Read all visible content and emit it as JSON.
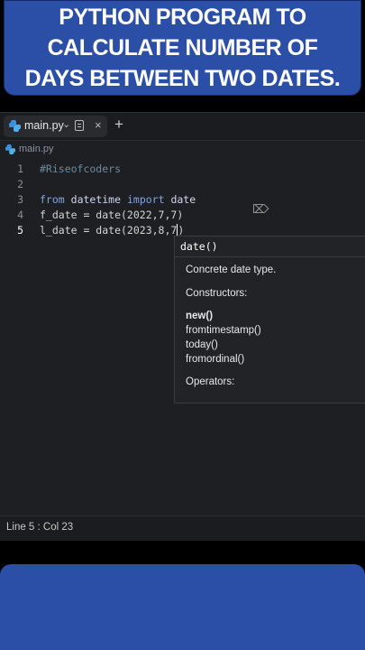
{
  "banner": {
    "lines": [
      "PYTHON PROGRAM TO",
      "CALCULATE NUMBER OF",
      "DAYS BETWEEN TWO DATES."
    ]
  },
  "colors": {
    "banner": "#2b4ea6",
    "editor_bg": "#1e1f22"
  },
  "tab": {
    "label": "main.py",
    "icon": "python-icon"
  },
  "breadcrumb": {
    "label": "main.py"
  },
  "code": {
    "line_numbers": [
      "1",
      "2",
      "3",
      "4",
      "5"
    ],
    "line1": {
      "comment": "#Riseofcoders"
    },
    "line3": {
      "kw1": "from",
      "mod": "datetime",
      "kw2": "import",
      "name": "date"
    },
    "line4": {
      "text": "f_date = date(2022,7,7)"
    },
    "line5": {
      "before": "l_date = date(2023,8,7",
      "after": ")"
    }
  },
  "popup": {
    "title": "date()",
    "description": "Concrete date type.",
    "constructors_label": "Constructors:",
    "constructors": [
      "new()",
      "fromtimestamp()",
      "today()",
      "fromordinal()"
    ],
    "operators_label": "Operators:"
  },
  "status": {
    "position": "Line 5 : Col 23"
  }
}
